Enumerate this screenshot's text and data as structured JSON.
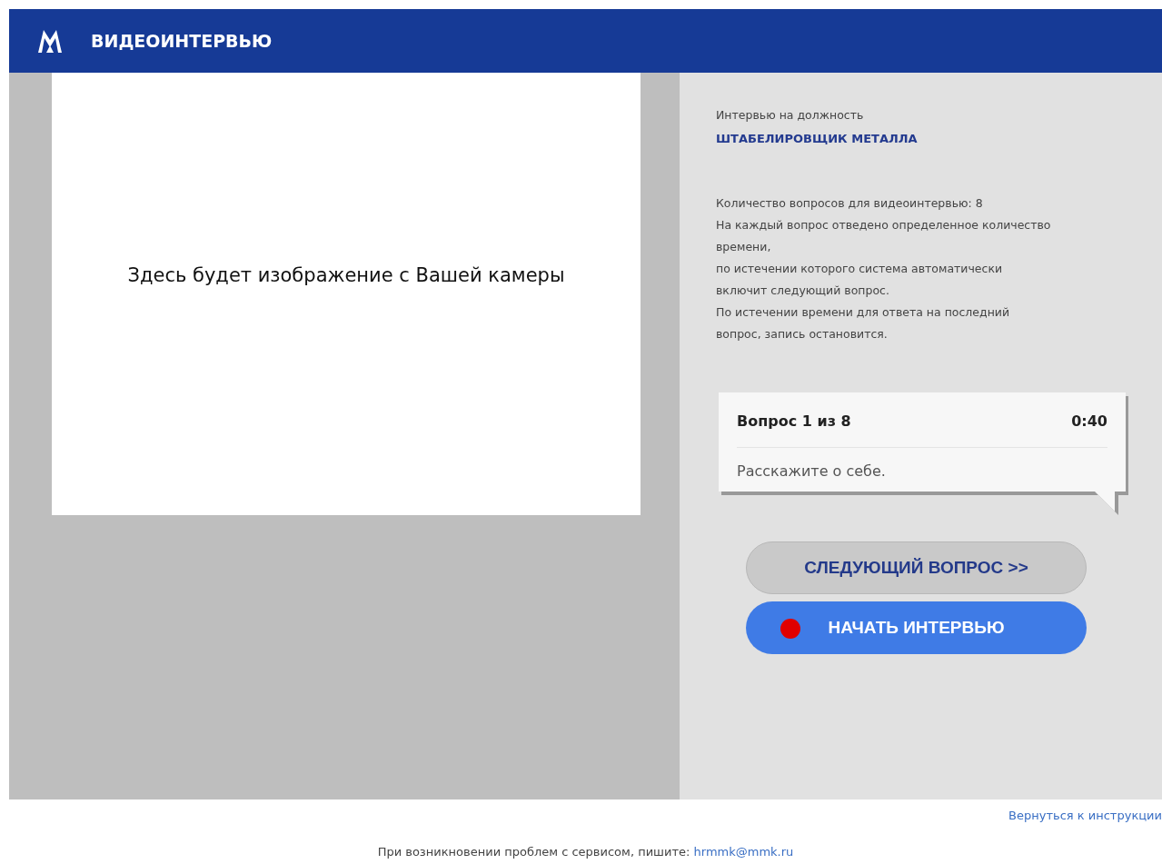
{
  "header": {
    "title": "ВИДЕОИНТЕРВЬЮ"
  },
  "camera": {
    "placeholder_text": "Здесь будет изображение с Вашей камеры"
  },
  "position": {
    "label": "Интервью на должность",
    "title": "ШТАБЕЛИРОВЩИК МЕТАЛЛА"
  },
  "info_lines": [
    "Количество вопросов для видеоинтервью: 8",
    "На каждый вопрос отведено определенное количество времени,",
    "по истечении которого система автоматически",
    "включит следующий вопрос.",
    "По истечении времени для ответа на последний",
    "вопрос, запись остановится."
  ],
  "question": {
    "counter": "Вопрос 1 из 8",
    "timer": "0:40",
    "text": "Расскажите о себе."
  },
  "buttons": [
    {
      "kind": "secondary",
      "label": "СЛЕДУЮЩИЙ ВОПРОС >>"
    },
    {
      "kind": "record",
      "label": "НАЧАТЬ ИНТЕРВЬЮ"
    }
  ],
  "back_link": "Вернуться к инструкции",
  "footer": {
    "text": "При возникновении проблем с сервисом, пишите:",
    "email": "hrmmk@mmk.ru"
  }
}
